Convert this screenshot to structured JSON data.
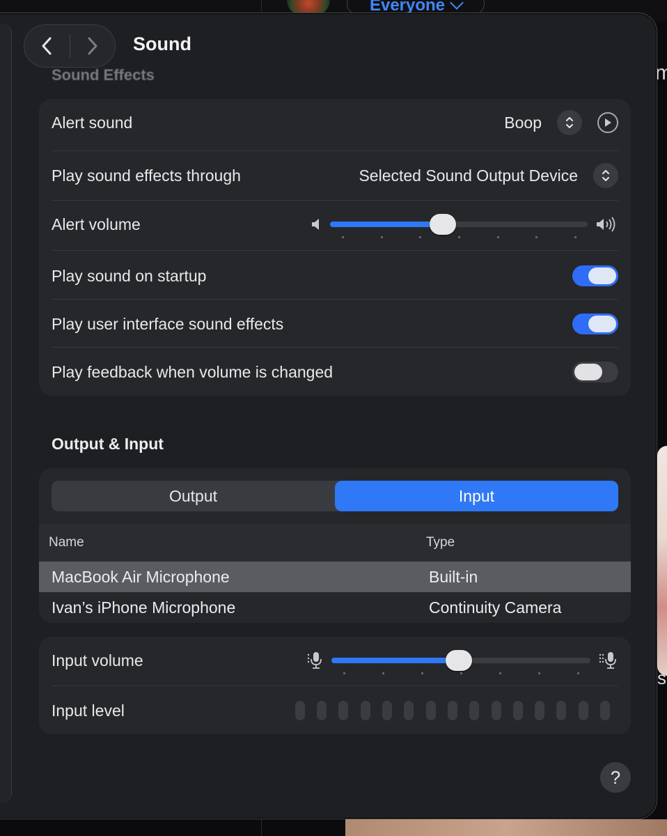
{
  "background": {
    "pill_label": "Everyone",
    "edge_letter_top": "m",
    "edge_letter_bottom": "s"
  },
  "window": {
    "title": "Sound",
    "faded_section_title": "Sound Effects"
  },
  "sound_effects": {
    "alert_sound": {
      "label": "Alert sound",
      "value": "Boop"
    },
    "play_through": {
      "label": "Play sound effects through",
      "value": "Selected Sound Output Device"
    },
    "alert_volume": {
      "label": "Alert volume",
      "level": 0.43
    },
    "startup": {
      "label": "Play sound on startup",
      "on": true
    },
    "ui_sounds": {
      "label": "Play user interface sound effects",
      "on": true
    },
    "feedback": {
      "label": "Play feedback when volume is changed",
      "on": false
    }
  },
  "output_input": {
    "heading": "Output & Input",
    "tabs": [
      {
        "label": "Output",
        "active": false
      },
      {
        "label": "Input",
        "active": true
      }
    ],
    "columns": {
      "name": "Name",
      "type": "Type"
    },
    "devices": [
      {
        "name": "MacBook Air Microphone",
        "type": "Built-in",
        "selected": true
      },
      {
        "name": "Ivan’s iPhone Microphone",
        "type": "Continuity Camera",
        "selected": false
      }
    ]
  },
  "input": {
    "volume": {
      "label": "Input volume",
      "level": 0.49
    },
    "level": {
      "label": "Input level",
      "bars": 15,
      "lit": 0
    }
  },
  "help": {
    "label": "?"
  },
  "colors": {
    "accent": "#2f78f6",
    "window_bg": "#1e1f22",
    "card_bg": "#26272b"
  }
}
